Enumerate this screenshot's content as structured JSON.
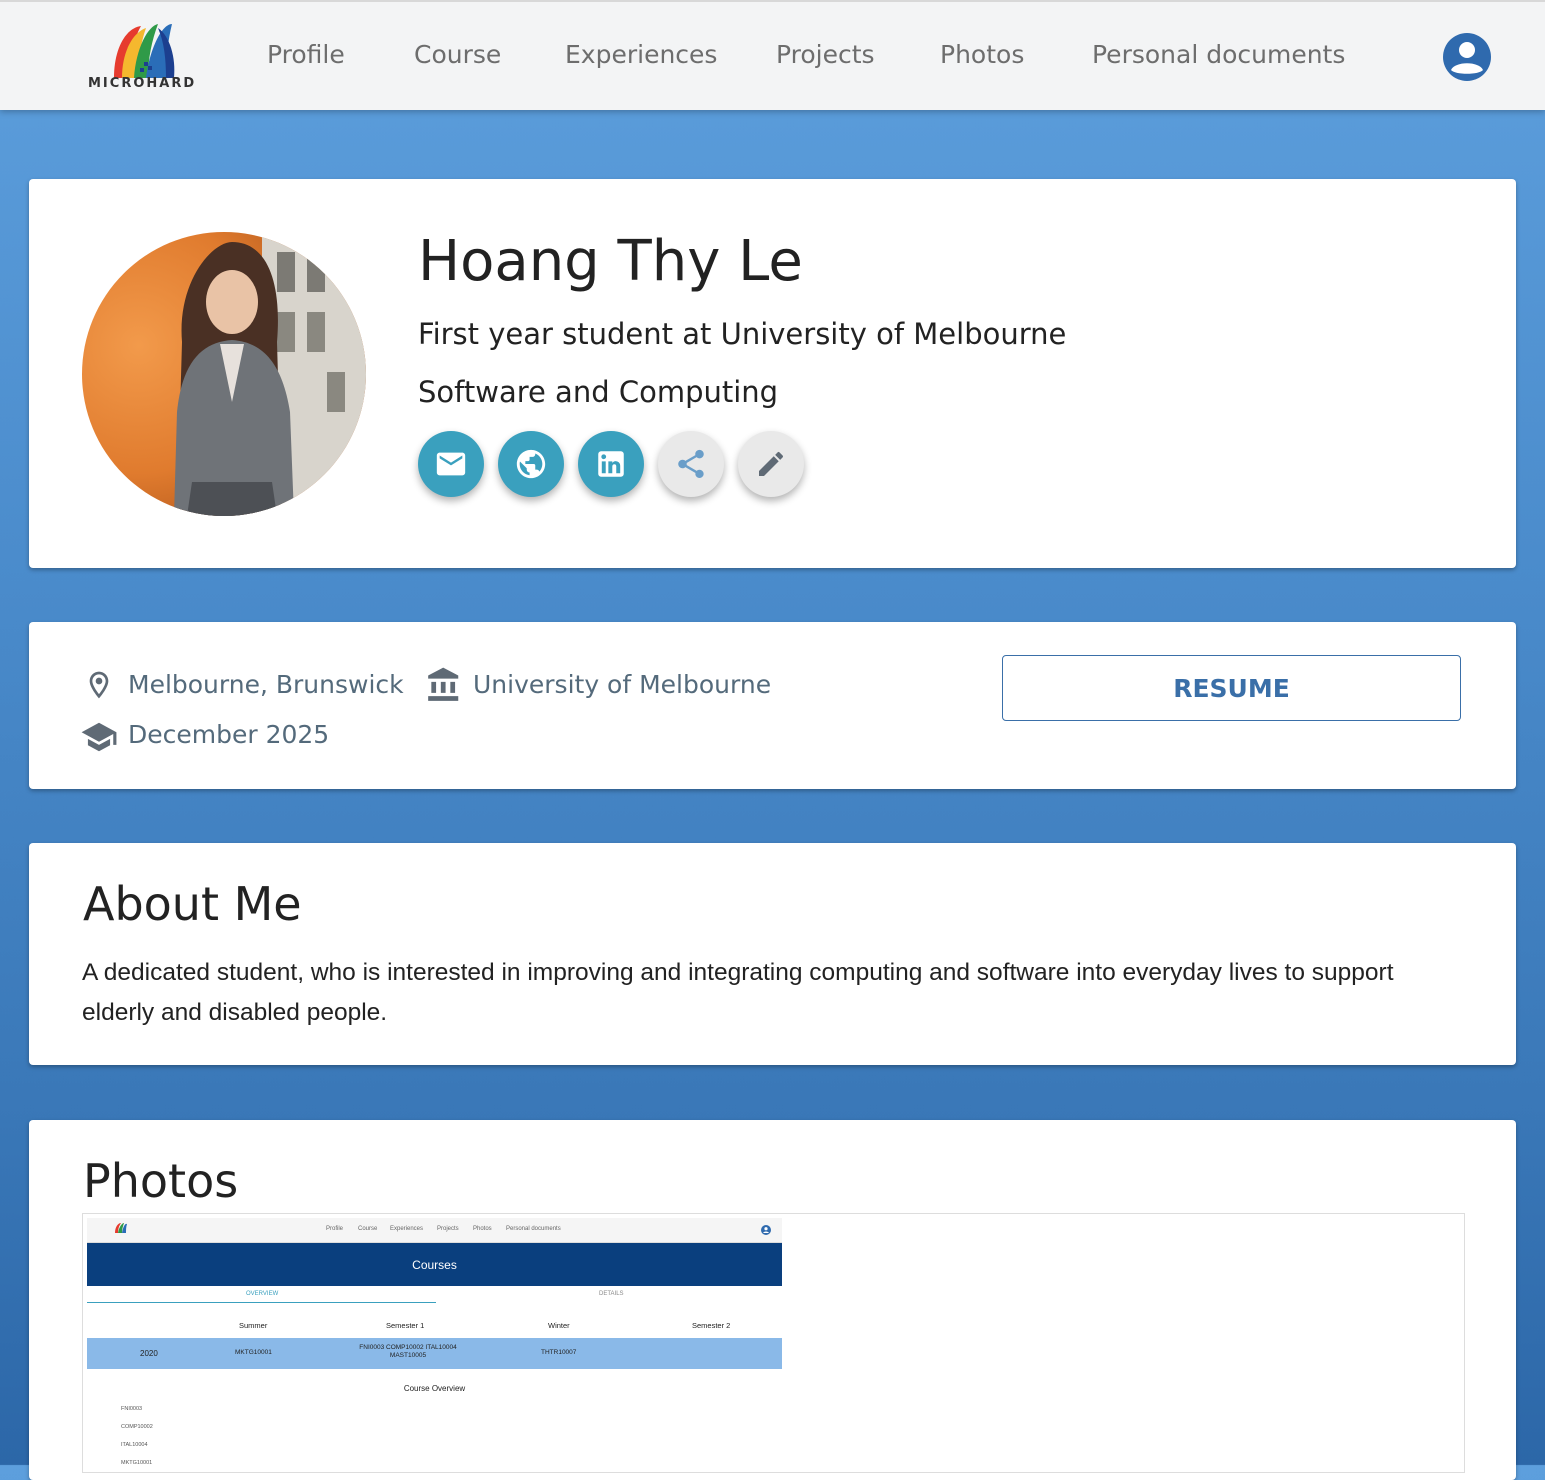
{
  "nav": {
    "logo_text": "MICROHARD",
    "items": [
      "Profile",
      "Course",
      "Experiences",
      "Projects",
      "Photos",
      "Personal documents"
    ]
  },
  "profile": {
    "name": "Hoang Thy Le",
    "subtitle": "First year student at University of Melbourne",
    "field": "Software and Computing",
    "buttons": [
      "email-icon",
      "globe-icon",
      "linkedin-icon",
      "share-icon",
      "edit-icon"
    ]
  },
  "info": {
    "location": "Melbourne, Brunswick",
    "university": "University of Melbourne",
    "graduation": "December 2025",
    "resume_label": "RESUME"
  },
  "about": {
    "title": "About Me",
    "text": "A dedicated student, who is interested in improving and integrating computing and software into everyday lives to support elderly and disabled people."
  },
  "photos": {
    "title": "Photos",
    "preview": {
      "nav": [
        "Profile",
        "Course",
        "Experiences",
        "Projects",
        "Photos",
        "Personal documents"
      ],
      "header": "Courses",
      "tabs": [
        "OVERVIEW",
        "DETAILS"
      ],
      "columns": [
        "Summer",
        "Semester 1",
        "Winter",
        "Semester 2"
      ],
      "row": {
        "year": "2020",
        "summer": "MKTG10001",
        "sem1": "FNI0003 COMP10002 ITAL10004 MAST10005",
        "winter": "THTR10007",
        "sem2": ""
      },
      "overview_title": "Course Overview",
      "overview_items": [
        "FNI0003",
        "COMP10002",
        "ITAL10004",
        "MKTG10001"
      ]
    }
  },
  "colors": {
    "accent_teal": "#3aa0be",
    "resume_blue": "#3a6fa8",
    "nav_bg": "#f3f4f5"
  }
}
